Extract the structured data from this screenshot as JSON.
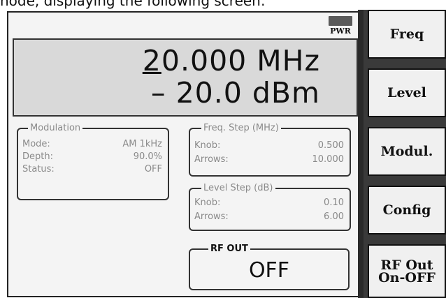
{
  "caption": "node, displaying the following screen:",
  "status": {
    "pwr_label": "PWR"
  },
  "display": {
    "frequency_first_digit": "2",
    "frequency_rest": "0.000 MHz",
    "level": "– 20.0 dBm"
  },
  "modulation": {
    "title": "Modulation",
    "rows": [
      {
        "label": "Mode:",
        "value": "AM 1kHz"
      },
      {
        "label": "Depth:",
        "value": "90.0%"
      },
      {
        "label": "Status:",
        "value": "OFF"
      }
    ]
  },
  "freq_step": {
    "title": "Freq. Step (MHz)",
    "rows": [
      {
        "label": "Knob:",
        "value": "0.500"
      },
      {
        "label": "Arrows:",
        "value": "10.000"
      }
    ]
  },
  "level_step": {
    "title": "Level Step (dB)",
    "rows": [
      {
        "label": "Knob:",
        "value": "0.10"
      },
      {
        "label": "Arrows:",
        "value": "6.00"
      }
    ]
  },
  "rf_out": {
    "title": "RF OUT",
    "value": "OFF"
  },
  "softkeys": {
    "freq": "Freq",
    "level": "Level",
    "modul": "Modul.",
    "config": "Config",
    "rfout_line1": "RF Out",
    "rfout_line2": "On-OFF"
  }
}
